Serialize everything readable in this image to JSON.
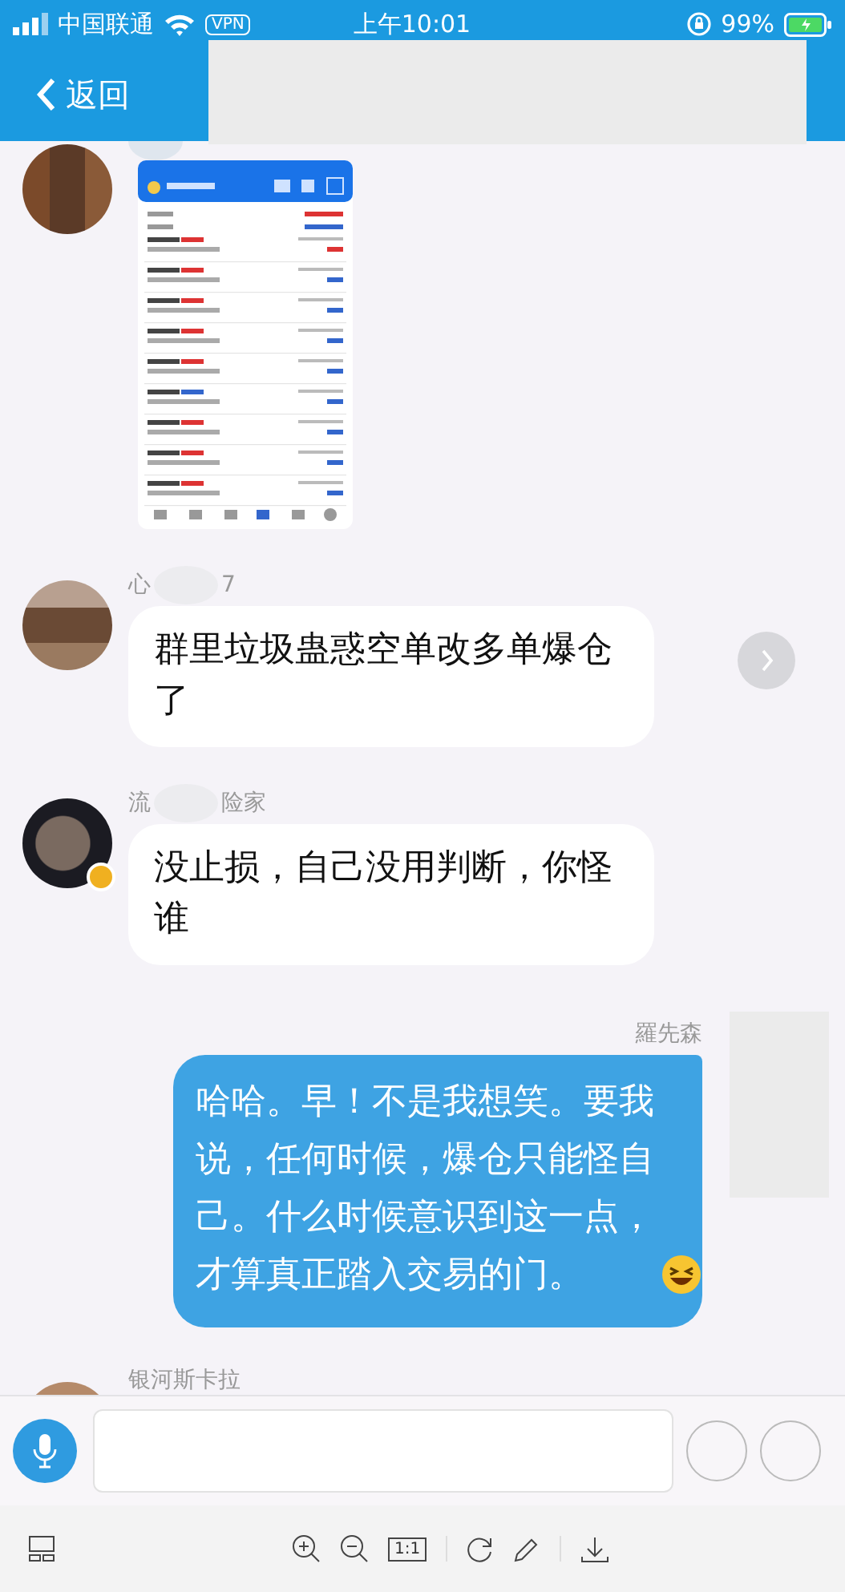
{
  "status_bar": {
    "carrier": "中国联通",
    "vpn": "VPN",
    "time": "上午10:01",
    "battery": "99%"
  },
  "nav": {
    "back": "返回"
  },
  "messages": [
    {
      "kind": "image"
    },
    {
      "kind": "incoming",
      "name_parts": [
        "心",
        "7"
      ],
      "text": "群里垃圾蛊惑空单改多单爆仓了",
      "forward": true
    },
    {
      "kind": "incoming",
      "name_parts": [
        "流",
        "险家"
      ],
      "text": "没止损，自己没用判断，你怪谁",
      "badge": true
    },
    {
      "kind": "outgoing",
      "name_parts": [
        "羅先森"
      ],
      "text": "哈哈。早！不是我想笑。要我说，任何时候，爆仓只能怪自己。什么时候意识到这一点，才算真正踏入交易的门。",
      "emoji": true
    },
    {
      "kind": "stub",
      "name_parts": [
        "银河斯卡拉"
      ]
    }
  ],
  "toolbar": {
    "actual_size": "1:1"
  }
}
